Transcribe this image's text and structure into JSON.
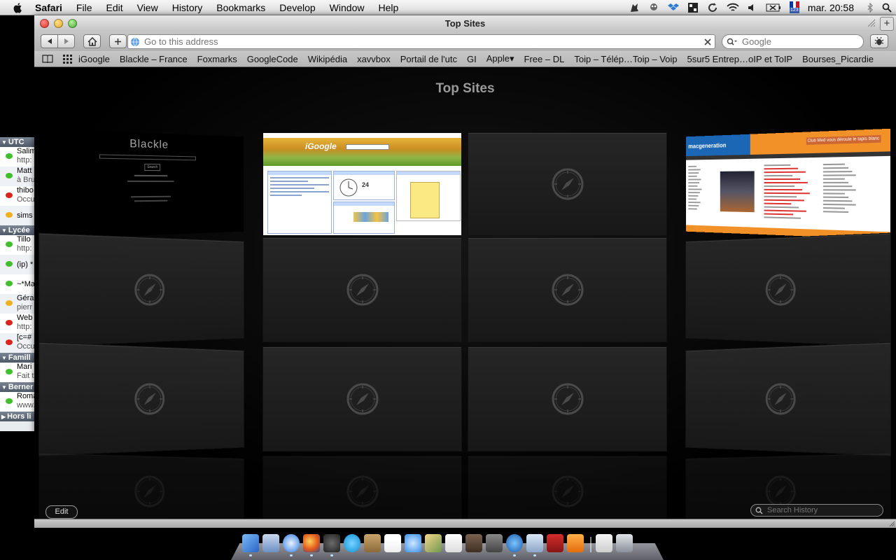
{
  "menubar": {
    "app": "Safari",
    "menus": [
      "File",
      "Edit",
      "View",
      "History",
      "Bookmarks",
      "Develop",
      "Window",
      "Help"
    ],
    "clock": "mar. 20:58",
    "input_indicator": "123"
  },
  "buddy_list": {
    "groups": [
      {
        "name": "UTC",
        "buddies": [
          {
            "l1": "Salim",
            "l2": "http:",
            "status": "green"
          },
          {
            "l1": "Matt",
            "l2": "à Bru",
            "status": "green"
          },
          {
            "l1": "thibo",
            "l2": "Occu",
            "status": "red"
          },
          {
            "l1": "sims",
            "l2": "",
            "status": "yellow"
          }
        ]
      },
      {
        "name": "Lycée",
        "buddies": [
          {
            "l1": "Tillo",
            "l2": "http:",
            "status": "green"
          },
          {
            "l1": "(ip) *",
            "l2": "",
            "status": "green"
          },
          {
            "l1": "~*Ma",
            "l2": "",
            "status": "green"
          },
          {
            "l1": "Géra",
            "l2": "pierr",
            "status": "yellow"
          },
          {
            "l1": "Web",
            "l2": "http:",
            "status": "red"
          },
          {
            "l1": "[c=#",
            "l2": "Occu",
            "status": "red"
          }
        ]
      },
      {
        "name": "Famill",
        "buddies": [
          {
            "l1": "Mari",
            "l2": "Fait t",
            "status": "green"
          }
        ]
      },
      {
        "name": "Berner",
        "buddies": [
          {
            "l1": "Roma",
            "l2": "www.",
            "status": "green"
          }
        ]
      },
      {
        "name": "Hors li",
        "collapsed": true,
        "buddies": []
      }
    ]
  },
  "window": {
    "title": "Top Sites",
    "address_placeholder": "Go to this address",
    "search_placeholder": "Google"
  },
  "bookmarks": [
    "iGoogle",
    "Blackle – France",
    "Foxmarks",
    "GoogleCode",
    "Wikipédia",
    "xavvbox",
    "Portail de l'utc",
    "GI",
    "Apple▾",
    "Free – DL",
    "Toip – Téléр…Toip – Voip",
    "5sur5 Entrep…oIP et ToIP",
    "Bourses_Picardie"
  ],
  "top_sites": {
    "heading": "Top Sites",
    "edit_label": "Edit",
    "history_search_placeholder": "Search History",
    "thumbs": {
      "blackle": {
        "logo": "Blackle",
        "sub": "Search"
      },
      "igoogle": {
        "logo": "iGoogle",
        "date_num": "24"
      },
      "macg": {
        "logo": "macgeneration",
        "promo": "Club Med vous déroule le tapis blanc"
      }
    }
  },
  "dock": {
    "apps": [
      "finder",
      "preview",
      "safari",
      "firefox",
      "adium",
      "skype",
      "contacts",
      "ical",
      "itunes",
      "iphoto",
      "textedit",
      "dictionary",
      "screen",
      "quicktime",
      "xcode",
      "acrobat",
      "vlc",
      "documents",
      "trash"
    ]
  }
}
